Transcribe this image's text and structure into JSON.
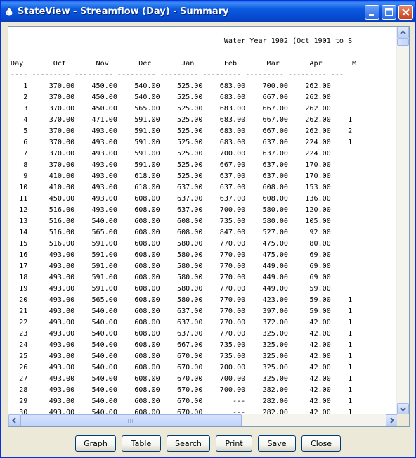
{
  "window": {
    "title": "StateView - Streamflow (Day) - Summary",
    "controls": {
      "minimize_icon": "minimize-icon",
      "maximize_icon": "maximize-icon",
      "close_icon": "close-icon"
    }
  },
  "report": {
    "heading": "Water Year 1902 (Oct 1901 to S",
    "columns": [
      "Day",
      "Oct",
      "Nov",
      "Dec",
      "Jan",
      "Feb",
      "Mar",
      "Apr",
      "M"
    ],
    "rows": [
      {
        "day": "1",
        "values": [
          "370.00",
          "450.00",
          "540.00",
          "525.00",
          "683.00",
          "700.00",
          "262.00"
        ],
        "edge": ""
      },
      {
        "day": "2",
        "values": [
          "370.00",
          "450.00",
          "540.00",
          "525.00",
          "683.00",
          "667.00",
          "262.00"
        ],
        "edge": ""
      },
      {
        "day": "3",
        "values": [
          "370.00",
          "450.00",
          "565.00",
          "525.00",
          "683.00",
          "667.00",
          "262.00"
        ],
        "edge": ""
      },
      {
        "day": "4",
        "values": [
          "370.00",
          "471.00",
          "591.00",
          "525.00",
          "683.00",
          "667.00",
          "262.00"
        ],
        "edge": "1"
      },
      {
        "day": "5",
        "values": [
          "370.00",
          "493.00",
          "591.00",
          "525.00",
          "683.00",
          "667.00",
          "262.00"
        ],
        "edge": "2"
      },
      {
        "day": "6",
        "values": [
          "370.00",
          "493.00",
          "591.00",
          "525.00",
          "683.00",
          "637.00",
          "224.00"
        ],
        "edge": "1"
      },
      {
        "day": "7",
        "values": [
          "370.00",
          "493.00",
          "591.00",
          "525.00",
          "700.00",
          "637.00",
          "224.00"
        ],
        "edge": ""
      },
      {
        "day": "8",
        "values": [
          "370.00",
          "493.00",
          "591.00",
          "525.00",
          "667.00",
          "637.00",
          "170.00"
        ],
        "edge": ""
      },
      {
        "day": "9",
        "values": [
          "410.00",
          "493.00",
          "618.00",
          "525.00",
          "637.00",
          "637.00",
          "170.00"
        ],
        "edge": ""
      },
      {
        "day": "10",
        "values": [
          "410.00",
          "493.00",
          "618.00",
          "637.00",
          "637.00",
          "608.00",
          "153.00"
        ],
        "edge": ""
      },
      {
        "day": "11",
        "values": [
          "450.00",
          "493.00",
          "608.00",
          "637.00",
          "637.00",
          "608.00",
          "136.00"
        ],
        "edge": ""
      },
      {
        "day": "12",
        "values": [
          "516.00",
          "493.00",
          "608.00",
          "637.00",
          "700.00",
          "580.00",
          "120.00"
        ],
        "edge": ""
      },
      {
        "day": "13",
        "values": [
          "516.00",
          "540.00",
          "608.00",
          "608.00",
          "735.00",
          "580.00",
          "105.00"
        ],
        "edge": ""
      },
      {
        "day": "14",
        "values": [
          "516.00",
          "565.00",
          "608.00",
          "608.00",
          "847.00",
          "527.00",
          "92.00"
        ],
        "edge": ""
      },
      {
        "day": "15",
        "values": [
          "516.00",
          "591.00",
          "608.00",
          "580.00",
          "770.00",
          "475.00",
          "80.00"
        ],
        "edge": ""
      },
      {
        "day": "16",
        "values": [
          "493.00",
          "591.00",
          "608.00",
          "580.00",
          "770.00",
          "475.00",
          "69.00"
        ],
        "edge": ""
      },
      {
        "day": "17",
        "values": [
          "493.00",
          "591.00",
          "608.00",
          "580.00",
          "770.00",
          "449.00",
          "69.00"
        ],
        "edge": ""
      },
      {
        "day": "18",
        "values": [
          "493.00",
          "591.00",
          "608.00",
          "580.00",
          "770.00",
          "449.00",
          "69.00"
        ],
        "edge": ""
      },
      {
        "day": "19",
        "values": [
          "493.00",
          "591.00",
          "608.00",
          "580.00",
          "770.00",
          "449.00",
          "59.00"
        ],
        "edge": ""
      },
      {
        "day": "20",
        "values": [
          "493.00",
          "565.00",
          "608.00",
          "580.00",
          "770.00",
          "423.00",
          "59.00"
        ],
        "edge": "1"
      },
      {
        "day": "21",
        "values": [
          "493.00",
          "540.00",
          "608.00",
          "637.00",
          "770.00",
          "397.00",
          "59.00"
        ],
        "edge": "1"
      },
      {
        "day": "22",
        "values": [
          "493.00",
          "540.00",
          "608.00",
          "637.00",
          "770.00",
          "372.00",
          "42.00"
        ],
        "edge": "1"
      },
      {
        "day": "23",
        "values": [
          "493.00",
          "540.00",
          "608.00",
          "637.00",
          "770.00",
          "325.00",
          "42.00"
        ],
        "edge": "1"
      },
      {
        "day": "24",
        "values": [
          "493.00",
          "540.00",
          "608.00",
          "667.00",
          "735.00",
          "325.00",
          "42.00"
        ],
        "edge": "1"
      },
      {
        "day": "25",
        "values": [
          "493.00",
          "540.00",
          "608.00",
          "670.00",
          "735.00",
          "325.00",
          "42.00"
        ],
        "edge": "1"
      },
      {
        "day": "26",
        "values": [
          "493.00",
          "540.00",
          "608.00",
          "670.00",
          "700.00",
          "325.00",
          "42.00"
        ],
        "edge": "1"
      },
      {
        "day": "27",
        "values": [
          "493.00",
          "540.00",
          "608.00",
          "670.00",
          "700.00",
          "325.00",
          "42.00"
        ],
        "edge": "1"
      },
      {
        "day": "28",
        "values": [
          "493.00",
          "540.00",
          "608.00",
          "670.00",
          "700.00",
          "282.00",
          "42.00"
        ],
        "edge": "1"
      },
      {
        "day": "29",
        "values": [
          "493.00",
          "540.00",
          "608.00",
          "670.00",
          "---",
          "282.00",
          "42.00"
        ],
        "edge": "1"
      },
      {
        "day": "30",
        "values": [
          "493.00",
          "540.00",
          "608.00",
          "670.00",
          "---",
          "282.00",
          "42.00"
        ],
        "edge": "1"
      }
    ]
  },
  "buttons": {
    "graph": "Graph",
    "table": "Table",
    "search": "Search",
    "print": "Print",
    "save": "Save",
    "close": "Close"
  },
  "colors": {
    "titlebar": "#0a5ae0",
    "window_bg": "#ece9d8",
    "close_button": "#c9401c"
  }
}
